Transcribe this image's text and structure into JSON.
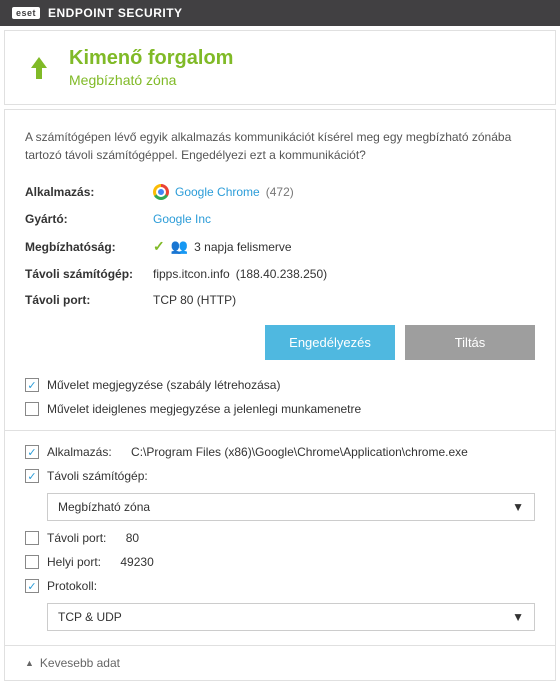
{
  "titlebar": {
    "brand": "eset",
    "product": "ENDPOINT SECURITY"
  },
  "header": {
    "title": "Kimenő forgalom",
    "subtitle": "Megbízható zóna"
  },
  "prompt": "A számítógépen lévő egyik alkalmazás kommunikációt kísérel meg egy megbízható zónába tartozó távoli számítógéppel. Engedélyezi ezt a kommunikációt?",
  "rows": {
    "app_label": "Alkalmazás:",
    "app_name": "Google Chrome",
    "app_count": "(472)",
    "vendor_label": "Gyártó:",
    "vendor_name": "Google Inc",
    "trust_label": "Megbízhatóság:",
    "trust_text": "3 napja felismerve",
    "remote_label": "Távoli számítógép:",
    "remote_host": "fipps.itcon.info",
    "remote_ip": "(188.40.238.250)",
    "port_label": "Távoli port:",
    "port_value": "TCP 80 (HTTP)"
  },
  "buttons": {
    "allow": "Engedélyezés",
    "deny": "Tiltás"
  },
  "remember": {
    "rule": "Művelet megjegyzése (szabály létrehozása)",
    "session": "Művelet ideiglenes megjegyzése a jelenlegi munkamenetre"
  },
  "details": {
    "app_label": "Alkalmazás:",
    "app_path": "C:\\Program Files (x86)\\Google\\Chrome\\Application\\chrome.exe",
    "remote_label": "Távoli számítógép:",
    "remote_select": "Megbízható zóna",
    "remote_port_label": "Távoli port:",
    "remote_port_value": "80",
    "local_port_label": "Helyi port:",
    "local_port_value": "49230",
    "protocol_label": "Protokoll:",
    "protocol_select": "TCP & UDP"
  },
  "footer": {
    "toggle": "Kevesebb adat"
  }
}
